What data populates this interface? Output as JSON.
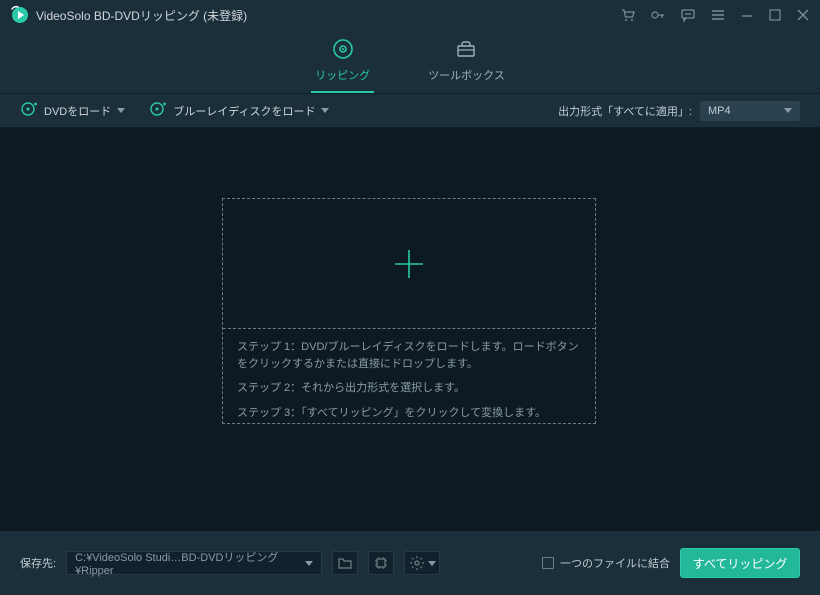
{
  "titlebar": {
    "title": "VideoSolo BD-DVDリッピング (未登録)"
  },
  "tabs": {
    "ripping": "リッピング",
    "toolbox": "ツールボックス"
  },
  "optbar": {
    "load_dvd": "DVDをロード",
    "load_bd": "ブルーレイディスクをロード",
    "output_label": "出力形式「すべてに適用」:",
    "output_value": "MP4"
  },
  "steps": {
    "s1": "ステップ 1：DVD/ブルーレイディスクをロードします。ロードボタンをクリックするかまたは直接にドロップします。",
    "s2": "ステップ 2：それから出力形式を選択します。",
    "s3": "ステップ 3：「すべてリッピング」をクリックして変換します。"
  },
  "bottom": {
    "save_label": "保存先:",
    "save_path": "C:¥VideoSolo Studi…BD-DVDリッピング¥Ripper",
    "merge_label": "一つのファイルに結合",
    "rip_label": "すべてリッピング"
  }
}
